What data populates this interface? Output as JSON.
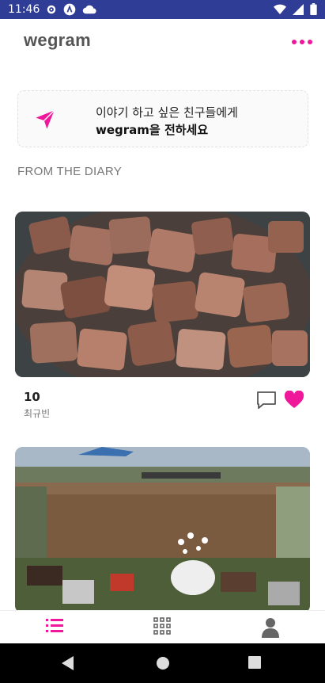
{
  "status_bar": {
    "time": "11:46",
    "icons": [
      "gear-icon",
      "app-icon",
      "cloud-icon",
      "wifi-icon",
      "signal-icon",
      "battery-icon"
    ],
    "background": "#2f3d97"
  },
  "header": {
    "logo": "wegram",
    "more_icon": "more-dots-icon",
    "accent_color": "#f0189a"
  },
  "banner": {
    "line1": "이야기 하고 싶은 친구들에게",
    "line2": "wegram을 전하세요",
    "icon": "send-icon"
  },
  "section": {
    "title": "FROM THE DIARY"
  },
  "posts": [
    {
      "image": "grilled-beef-photo",
      "count": "10",
      "author": "최규빈",
      "comment_icon": "comment-icon",
      "like_icon": "heart-icon"
    },
    {
      "image": "garden-field-photo"
    }
  ],
  "bottom_nav": {
    "items": [
      "list-icon",
      "grid-icon",
      "profile-icon"
    ],
    "active_color": "#f0189a"
  },
  "system_nav": {
    "items": [
      "back-icon",
      "home-icon",
      "recents-icon"
    ]
  }
}
